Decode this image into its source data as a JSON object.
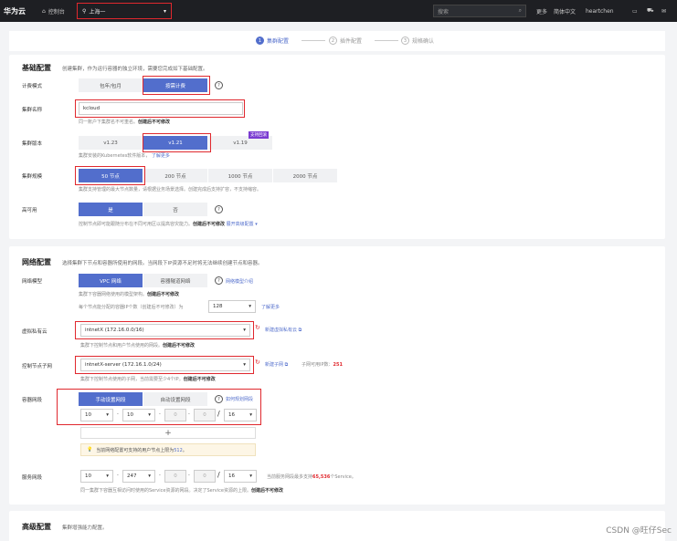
{
  "topbar": {
    "logo": "华为云",
    "home": "控制台",
    "region": "上海一",
    "search_placeholder": "搜索",
    "menu": [
      "更多",
      "简体中文",
      "heartchen"
    ]
  },
  "steps": [
    {
      "num": "1",
      "label": "集群配置"
    },
    {
      "num": "2",
      "label": "插件配置"
    },
    {
      "num": "3",
      "label": "规格确认"
    }
  ],
  "basic": {
    "title": "基础配置",
    "desc": "创建集群，作为运行容器的独立环境，需要您完成如下基础配置。",
    "billing": {
      "label": "计费模式",
      "options": [
        "包年/包月",
        "按需计费"
      ],
      "selected": 1
    },
    "name": {
      "label": "集群名称",
      "value": "kcloud",
      "hint1": "同一账户下集群名不可重名。",
      "hint2": "创建后不可修改"
    },
    "version": {
      "label": "集群版本",
      "options": [
        "v1.23",
        "v1.21",
        "v1.19"
      ],
      "selected": 1,
      "badge": "支持回滚",
      "hint": "集群安装的Kubernetes软件版本，",
      "link": "了解更多"
    },
    "scale": {
      "label": "集群规模",
      "options": [
        "50 节点",
        "200 节点",
        "1000 节点",
        "2000 节点"
      ],
      "selected": 0,
      "hint": "集群支持管理的最大节点数量，请根据业务场景选择。创建完成后支持扩容，不支持缩容。"
    },
    "ha": {
      "label": "高可用",
      "options": [
        "是",
        "否"
      ],
      "selected": 0,
      "hint1": "控制节点即可能跟随分布在不同可用区以提高容灾能力。",
      "hint2": "创建后不可修改",
      "link": "展开高级配置"
    }
  },
  "network": {
    "title": "网络配置",
    "desc": "选择集群下节点和容器所使用的网段。当网段下IP资源不足时将无法继续创建节点和容器。",
    "model": {
      "label": "网络模型",
      "options": [
        "VPC 网络",
        "容器隧道网络"
      ],
      "selected": 0,
      "link": "网络模型介绍",
      "hint1": "集群下容器网络使用的模型架构。",
      "hint2": "创建后不可修改"
    },
    "pods": {
      "hint": "每个节点能分配的容器IP个数（创建后不可修改）为",
      "value": "128",
      "link": "了解更多"
    },
    "vpc": {
      "label": "虚拟私有云",
      "value": "intnetX (172.16.0.0/16)",
      "link": "新建虚拟私有云",
      "hint1": "集群下控制节点和用户节点使用的网段。",
      "hint2": "创建后不可修改"
    },
    "subnet": {
      "label": "控制节点子网",
      "value": "intnetX-server (172.16.1.0/24)",
      "link": "新建子网",
      "ip_label": "子网可用IP数：",
      "ip_count": "251",
      "hint": "集群下控制节点使用的子网，当前需要至少4个IP。",
      "hint2": "创建后不可修改"
    },
    "container_cidr": {
      "label": "容器网段",
      "options": [
        "手动设置网段",
        "自动设置网段"
      ],
      "selected": 0,
      "link": "如何规划网段",
      "octets": [
        "10",
        "10",
        "0",
        "0"
      ],
      "mask": "16",
      "tip1": "当前网络配置可支持的用户节点上限为",
      "tip_num": "512",
      "tip2": "。"
    },
    "service_cidr": {
      "label": "服务网段",
      "octets": [
        "10",
        "247",
        "0",
        "0"
      ],
      "mask": "16",
      "hint_a": "当前服务网段最多支持",
      "hint_num": "65,536",
      "hint_b": "个Service。",
      "hint": "同一集群下容器互相访问时使用的Service资源的网段。决定了Service资源的上限。",
      "hint2": "创建后不可修改"
    }
  },
  "advanced": {
    "title": "高级配置",
    "desc": "集群增强能力配置。"
  },
  "watermark": "CSDN @旺仔Sec",
  "colors": {
    "primary": "#526ecc",
    "highlight": "#e0282e",
    "topbar": "#1e1f23"
  }
}
